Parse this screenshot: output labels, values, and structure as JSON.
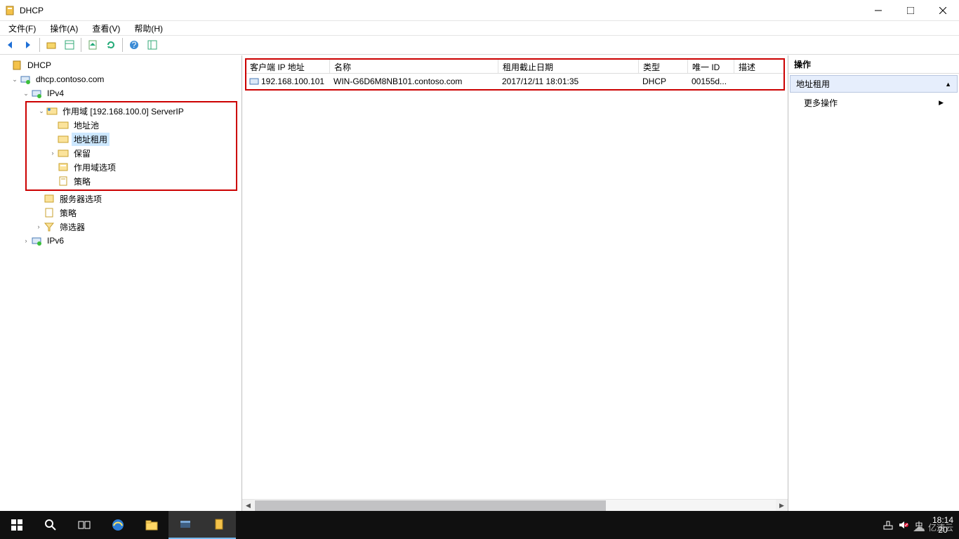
{
  "window": {
    "title": "DHCP"
  },
  "menu": {
    "file": "文件(F)",
    "action": "操作(A)",
    "view": "查看(V)",
    "help": "帮助(H)"
  },
  "tree": {
    "root": "DHCP",
    "server": "dhcp.contoso.com",
    "ipv4": "IPv4",
    "ipv6": "IPv6",
    "scope": "作用域 [192.168.100.0] ServerIP",
    "address_pool": "地址池",
    "address_leases": "地址租用",
    "reservations": "保留",
    "scope_options": "作用域选项",
    "policies": "策略",
    "server_options": "服务器选项",
    "server_policies": "策略",
    "filters": "筛选器"
  },
  "list": {
    "columns": {
      "client_ip": "客户端 IP 地址",
      "name": "名称",
      "lease_exp": "租用截止日期",
      "type": "类型",
      "unique_id": "唯一 ID",
      "desc": "描述"
    },
    "rows": [
      {
        "client_ip": "192.168.100.101",
        "name": "WIN-G6D6M8NB101.contoso.com",
        "lease_exp": "2017/12/11 18:01:35",
        "type": "DHCP",
        "unique_id": "00155d...",
        "desc": ""
      }
    ]
  },
  "actions": {
    "header": "操作",
    "section": "地址租用",
    "more": "更多操作"
  },
  "taskbar": {
    "time": "18:14",
    "date_frag": "20",
    "ime": "中"
  },
  "watermark": "亿速云"
}
